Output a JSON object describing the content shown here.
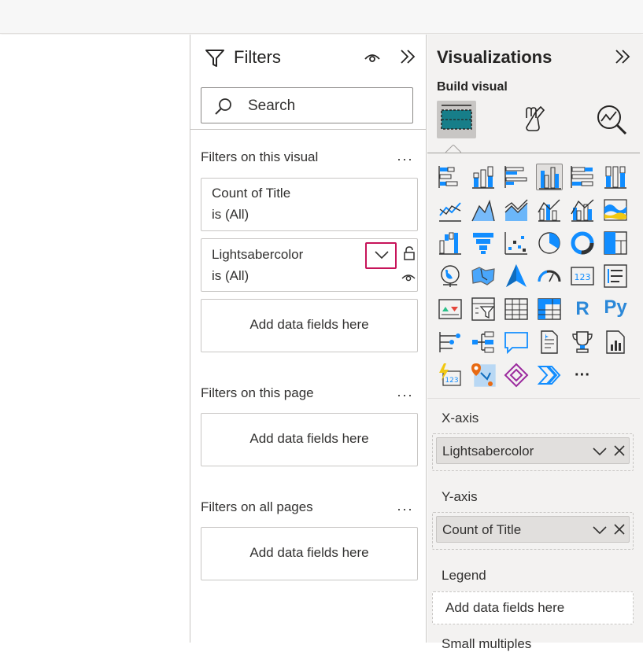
{
  "filters_pane": {
    "title": "Filters",
    "search_placeholder": "Search",
    "sections": {
      "visual": {
        "title": "Filters on this visual",
        "more": "···"
      },
      "page": {
        "title": "Filters on this page",
        "more": "···"
      },
      "all": {
        "title": "Filters on all pages",
        "more": "···"
      }
    },
    "visual_filters": [
      {
        "field": "Count of Title",
        "condition": "is (All)"
      },
      {
        "field": "Lightsabercolor",
        "condition": "is (All)"
      }
    ],
    "drop_text": "Add data fields here"
  },
  "viz_pane": {
    "title": "Visualizations",
    "build_label": "Build visual",
    "icon_text": {
      "r": "R",
      "py": "Py",
      "kpi": "123",
      "more": "···"
    },
    "wells": {
      "x_axis": {
        "label": "X-axis",
        "field": "Lightsabercolor"
      },
      "y_axis": {
        "label": "Y-axis",
        "field": "Count of Title"
      },
      "legend": {
        "label": "Legend",
        "placeholder": "Add data fields here"
      },
      "small_multiples": {
        "label": "Small multiples"
      }
    }
  },
  "colors": {
    "accent": "#118dff",
    "teal": "#177e89",
    "highlight": "#c7145a",
    "pane_bg": "#f3f2f1"
  }
}
